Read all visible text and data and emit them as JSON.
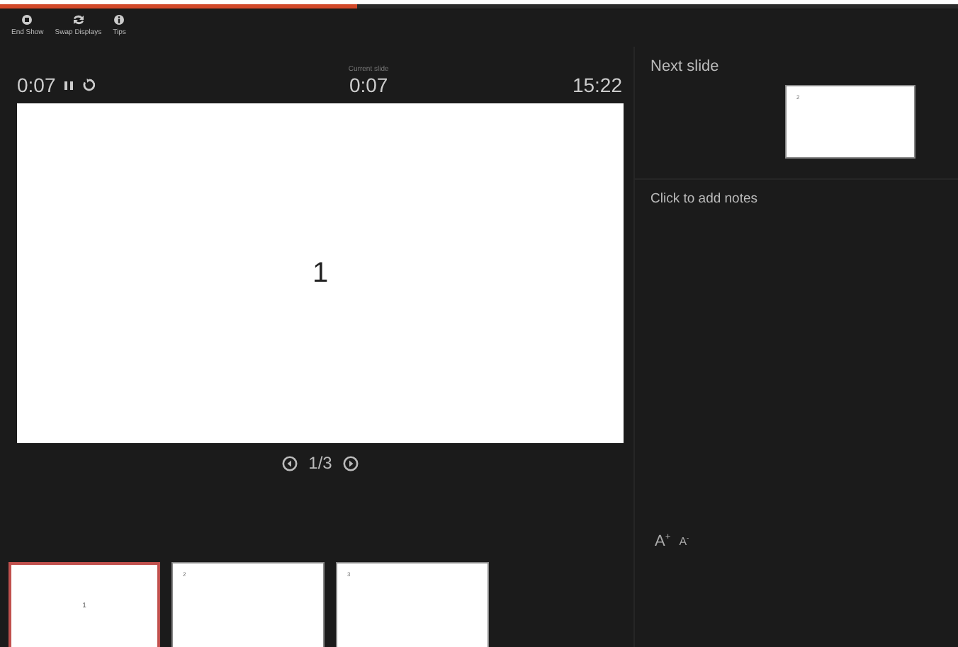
{
  "progress": {
    "level": 0.373
  },
  "toolbar": [
    {
      "label": "End Show",
      "kind": "end"
    },
    {
      "label": "Swap Displays",
      "kind": "swap"
    },
    {
      "label": "Tips",
      "kind": "tips"
    }
  ],
  "timer": {
    "elapsed": "0:07",
    "current_label": "Current slide",
    "current_time": "0:07",
    "clock": "15:22"
  },
  "slide": {
    "text": "1"
  },
  "navigation": {
    "position": "1/3"
  },
  "next_slide": {
    "heading": "Next slide",
    "thumb_text": "2"
  },
  "notes": {
    "placeholder": "Click to add notes"
  },
  "font_buttons": [
    {
      "label": "A$^{+}$",
      "kind": "grow"
    },
    {
      "label": "A$^{-}$",
      "kind": "shrink"
    }
  ],
  "thumbnails": [
    {
      "text": "1",
      "kind": "title",
      "selected": true
    },
    {
      "text": "2",
      "kind": "corner",
      "selected": false
    },
    {
      "text": "3",
      "kind": "corner",
      "selected": false
    }
  ]
}
